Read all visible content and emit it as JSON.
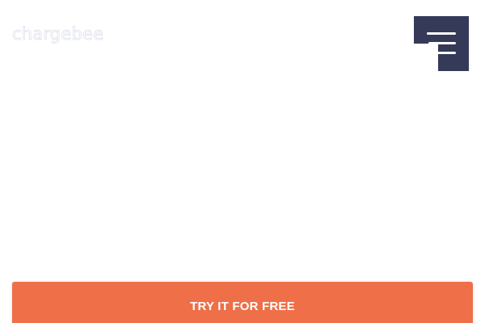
{
  "header": {
    "logo_text": "chargebee",
    "menu_icon": "hamburger-icon"
  },
  "cta": {
    "label": "TRY IT FOR FREE"
  },
  "colors": {
    "menu_button_bg": "#363a59",
    "cta_bg": "#ee6f48",
    "logo_outline": "#d9dde8"
  }
}
